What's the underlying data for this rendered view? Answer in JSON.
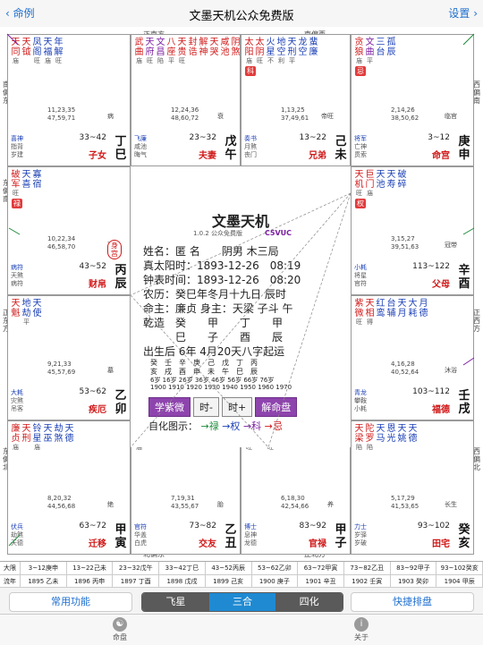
{
  "nav": {
    "back_label": "命例",
    "title": "文墨天机公众免费版",
    "settings_label": "设置"
  },
  "directions": {
    "top_left": "正南方",
    "top_right": "南偏西",
    "left_top": "南偏东",
    "left_mid": "东偏南",
    "left_mid2": "正东方",
    "left_bottom": "东偏北",
    "right_top": "西偏南",
    "right_mid": "正西方",
    "right_bottom": "西偏北",
    "bottom_left": "北偏东",
    "bottom_right": "正北方"
  },
  "palaces": [
    {
      "id": "si",
      "stars": [
        {
          "n": "天同",
          "c": "red",
          "b": "庙"
        },
        {
          "n": "天钺",
          "c": "red",
          "b": ""
        },
        {
          "n": "凤阁",
          "c": "blue",
          "b": "旺"
        },
        {
          "n": "天福",
          "c": "blue",
          "b": "庙"
        },
        {
          "n": "年解",
          "c": "blue",
          "b": "旺"
        }
      ],
      "ages": "11,23,35\n47,59,71",
      "state": "病",
      "gods": [
        {
          "t": "喜神",
          "c": "blue"
        },
        {
          "t": "指背",
          "c": "gray"
        },
        {
          "t": "岁建",
          "c": "gray"
        }
      ],
      "range": "33~42",
      "name": "子女",
      "gz": "丁巳"
    },
    {
      "id": "wu",
      "stars": [
        {
          "n": "武曲",
          "c": "red",
          "b": "庙"
        },
        {
          "n": "天府",
          "c": "purple",
          "b": "旺"
        },
        {
          "n": "文昌",
          "c": "purple",
          "b": "陷"
        },
        {
          "n": "八座",
          "c": "red",
          "b": "平"
        },
        {
          "n": "天贵",
          "c": "red",
          "b": "旺"
        },
        {
          "n": "封诰",
          "c": "red",
          "b": ""
        },
        {
          "n": "解神",
          "c": "red",
          "b": ""
        },
        {
          "n": "天哭",
          "c": "red",
          "b": ""
        },
        {
          "n": "咸池",
          "c": "red",
          "b": ""
        },
        {
          "n": "阴煞",
          "c": "red",
          "b": ""
        }
      ],
      "ages": "12,24,36\n48,60,72",
      "state": "衰",
      "gods": [
        {
          "t": "飞廉",
          "c": "blue"
        },
        {
          "t": "咸池",
          "c": "gray"
        },
        {
          "t": "晦气",
          "c": "gray"
        }
      ],
      "range": "23~32",
      "name": "夫妻",
      "gz": "戊午"
    },
    {
      "id": "wei",
      "stars": [
        {
          "n": "太阳",
          "c": "red",
          "b": "庙"
        },
        {
          "n": "太阴",
          "c": "red",
          "b": "旺"
        },
        {
          "n": "火星",
          "c": "blue",
          "b": "不"
        },
        {
          "n": "地空",
          "c": "blue",
          "b": "利"
        },
        {
          "n": "天刑",
          "c": "blue",
          "b": "平"
        },
        {
          "n": "龙空",
          "c": "blue",
          "b": ""
        },
        {
          "n": "蜚廉",
          "c": "blue",
          "b": ""
        }
      ],
      "tag": "科",
      "ages": "1,13,25\n37,49,61",
      "state": "帝旺",
      "gods": [
        {
          "t": "奏书",
          "c": "blue"
        },
        {
          "t": "月煞",
          "c": "gray"
        },
        {
          "t": "丧门",
          "c": "gray"
        }
      ],
      "range": "13~22",
      "name": "兄弟",
      "gz": "己未"
    },
    {
      "id": "shen",
      "stars": [
        {
          "n": "贪狼",
          "c": "red",
          "b": "庙"
        },
        {
          "n": "文曲",
          "c": "purple",
          "b": "平"
        },
        {
          "n": "三台",
          "c": "blue",
          "b": ""
        },
        {
          "n": "孤辰",
          "c": "blue",
          "b": ""
        }
      ],
      "tag": "忌",
      "ages": "2,14,26\n38,50,62",
      "state": "临官",
      "gods": [
        {
          "t": "将军",
          "c": "blue"
        },
        {
          "t": "亡神",
          "c": "gray"
        },
        {
          "t": "贯索",
          "c": "gray"
        }
      ],
      "range": "3~12",
      "name": "命宫",
      "gz": "庚申"
    },
    {
      "id": "chen",
      "stars": [
        {
          "n": "破军",
          "c": "red",
          "b": "旺"
        },
        {
          "n": "天喜",
          "c": "blue",
          "b": ""
        },
        {
          "n": "寡宿",
          "c": "blue",
          "b": ""
        }
      ],
      "tag": "禄",
      "ages": "10,22,34\n46,58,70",
      "state": "死",
      "gods": [
        {
          "t": "病符",
          "c": "blue"
        },
        {
          "t": "天煞",
          "c": "gray"
        },
        {
          "t": "病符",
          "c": "gray"
        }
      ],
      "range": "43~52",
      "name": "财帛",
      "gz": "丙辰"
    },
    {
      "id": "you",
      "stars": [
        {
          "n": "天机",
          "c": "red",
          "b": "旺"
        },
        {
          "n": "巨门",
          "c": "red",
          "b": "庙"
        },
        {
          "n": "天池",
          "c": "blue",
          "b": ""
        },
        {
          "n": "天寿",
          "c": "blue",
          "b": ""
        },
        {
          "n": "破碎",
          "c": "blue",
          "b": ""
        }
      ],
      "tag": "权",
      "ages": "3,15,27\n39,51,63",
      "state": "冠带",
      "gods": [
        {
          "t": "小耗",
          "c": "blue"
        },
        {
          "t": "将星",
          "c": "gray"
        },
        {
          "t": "官符",
          "c": "gray"
        }
      ],
      "range": "113~122",
      "name": "父母",
      "gz": "辛酉"
    },
    {
      "id": "mao",
      "stars": [
        {
          "n": "天魁",
          "c": "red",
          "b": ""
        },
        {
          "n": "地劫",
          "c": "blue",
          "b": "平"
        },
        {
          "n": "天使",
          "c": "blue",
          "b": ""
        }
      ],
      "ages": "9,21,33\n45,57,69",
      "state": "墓",
      "gods": [
        {
          "t": "大耗",
          "c": "blue"
        },
        {
          "t": "灾煞",
          "c": "gray"
        },
        {
          "t": "吊客",
          "c": "gray"
        }
      ],
      "range": "53~62",
      "name": "疾厄",
      "gz": "乙卯"
    },
    {
      "id": "xu",
      "stars": [
        {
          "n": "紫微",
          "c": "red",
          "b": "旺"
        },
        {
          "n": "天相",
          "c": "red",
          "b": "得"
        },
        {
          "n": "红鸾",
          "c": "blue",
          "b": ""
        },
        {
          "n": "台辅",
          "c": "blue",
          "b": ""
        },
        {
          "n": "天月",
          "c": "blue",
          "b": ""
        },
        {
          "n": "大耗",
          "c": "blue",
          "b": ""
        },
        {
          "n": "月德",
          "c": "blue",
          "b": ""
        }
      ],
      "ages": "4,16,28\n40,52,64",
      "state": "沐浴",
      "gods": [
        {
          "t": "青龙",
          "c": "blue"
        },
        {
          "t": "攀鞍",
          "c": "gray"
        },
        {
          "t": "小耗",
          "c": "gray"
        }
      ],
      "range": "103~112",
      "name": "福德",
      "gz": "壬戌"
    },
    {
      "id": "yin",
      "stars": [
        {
          "n": "廉贞",
          "c": "red",
          "b": "庙"
        },
        {
          "n": "天刑",
          "c": "red",
          "b": ""
        },
        {
          "n": "铃星",
          "c": "blue",
          "b": "庙"
        },
        {
          "n": "天巫",
          "c": "blue",
          "b": ""
        },
        {
          "n": "劫煞",
          "c": "blue",
          "b": ""
        },
        {
          "n": "天德",
          "c": "blue",
          "b": ""
        }
      ],
      "ages": "8,20,32\n44,56,68",
      "state": "绝",
      "gods": [
        {
          "t": "伏兵",
          "c": "blue"
        },
        {
          "t": "劫煞",
          "c": "gray"
        },
        {
          "t": "天德",
          "c": "gray"
        }
      ],
      "range": "63~72",
      "name": "迁移",
      "gz": "甲寅"
    },
    {
      "id": "chou",
      "stars": [
        {
          "n": "擎羊",
          "c": "red",
          "b": "庙"
        },
        {
          "n": "天贵",
          "c": "blue",
          "b": ""
        },
        {
          "n": "天才",
          "c": "blue",
          "b": ""
        },
        {
          "n": "截空",
          "c": "blue",
          "b": ""
        },
        {
          "n": "天伤",
          "c": "blue",
          "b": ""
        },
        {
          "n": "华盖",
          "c": "blue",
          "b": ""
        }
      ],
      "ages": "7,19,31\n43,55,67",
      "state": "胎",
      "gods": [
        {
          "t": "官符",
          "c": "blue"
        },
        {
          "t": "华盖",
          "c": "gray"
        },
        {
          "t": "白虎",
          "c": "gray"
        }
      ],
      "range": "73~82",
      "name": "交友",
      "gz": "乙丑"
    },
    {
      "id": "zi",
      "stars": [
        {
          "n": "七杀",
          "c": "red",
          "b": "旺"
        },
        {
          "n": "右弼",
          "c": "red",
          "b": ""
        },
        {
          "n": "禄存",
          "c": "red",
          "b": "旺"
        },
        {
          "n": "副截",
          "c": "blue",
          "b": ""
        },
        {
          "n": "龙德",
          "c": "blue",
          "b": ""
        }
      ],
      "ages": "6,18,30\n42,54,66",
      "state": "养",
      "gods": [
        {
          "t": "博士",
          "c": "blue"
        },
        {
          "t": "息神",
          "c": "gray"
        },
        {
          "t": "龙德",
          "c": "gray"
        }
      ],
      "range": "83~92",
      "name": "官禄",
      "gz": "甲子"
    },
    {
      "id": "hai",
      "stars": [
        {
          "n": "天梁",
          "c": "red",
          "b": "陷"
        },
        {
          "n": "陀罗",
          "c": "red",
          "b": "陷"
        },
        {
          "n": "天马",
          "c": "blue",
          "b": ""
        },
        {
          "n": "恩光",
          "c": "blue",
          "b": ""
        },
        {
          "n": "天姚",
          "c": "blue",
          "b": ""
        },
        {
          "n": "天德",
          "c": "blue",
          "b": ""
        }
      ],
      "ages": "5,17,29\n41,53,65",
      "state": "长生",
      "gods": [
        {
          "t": "力士",
          "c": "blue"
        },
        {
          "t": "岁驿",
          "c": "gray"
        },
        {
          "t": "岁破",
          "c": "gray"
        }
      ],
      "range": "93~102",
      "name": "田宅",
      "gz": "癸亥"
    }
  ],
  "center": {
    "title": "文墨天机",
    "version": "1.0.2 公众免费版",
    "code": "C5VUC",
    "side_tag": "身宫",
    "lines": [
      "姓名：匿 名　　阴男 木三局",
      "真太阳时：1893-12-26　08:19",
      "钟表时间：1893-12-26　08:20",
      "农历：癸巳年冬月十九日 辰时",
      "命主：廉贞 身主：天梁 子斗 午",
      "乾造　癸　　甲　　丁　　甲",
      "　　　巳　　子　　酉　　辰",
      "出生后 6年 4月20天八字起运"
    ],
    "dayun_top": "癸　壬　辛　庚　己　戊　丁　丙",
    "dayun_mid": "亥　戌　酉　申　未　午　巳　辰",
    "dayun_ages": "6岁 16岁 26岁 36岁 46岁 56岁 66岁 76岁",
    "dayun_years": "1900 1910 1920 1930 1940 1950 1960 1970",
    "btn_ziwei": "学紫微",
    "btn_time_minus": "时-",
    "btn_time_plus": "时+",
    "btn_jieming": "解命盘",
    "legend_label": "自化图示：",
    "legend_lu": "→禄",
    "legend_quan": "→权",
    "legend_ke": "→科",
    "legend_ji": "→忌"
  },
  "dayun_table": {
    "row1_label": "大限",
    "row1": [
      "3~12庚申",
      "13~22己未",
      "23~32戊午",
      "33~42丁巳",
      "43~52丙辰",
      "53~62乙卯",
      "63~72甲寅",
      "73~82乙丑",
      "83~92甲子",
      "93~102癸亥"
    ],
    "row2_label": "流年",
    "row2": [
      "1895 乙未",
      "1896 丙申",
      "1897 丁酉",
      "1898 戊戌",
      "1899 己亥",
      "1900 庚子",
      "1901 辛丑",
      "1902 壬寅",
      "1903 癸卯",
      "1904 甲辰"
    ]
  },
  "segbar": {
    "left": "常用功能",
    "seg1": "飞星",
    "seg2": "三合",
    "seg3": "四化",
    "right": "快捷排盘"
  },
  "tabs": {
    "tab1": "命盘",
    "tab2": "关于"
  }
}
